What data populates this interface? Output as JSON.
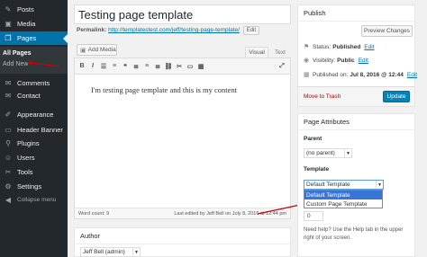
{
  "sidebar": {
    "items": [
      {
        "label": "Posts",
        "icon": "pin-icon"
      },
      {
        "label": "Media",
        "icon": "media-icon"
      },
      {
        "label": "Pages",
        "icon": "pages-icon"
      },
      {
        "label": "Comments",
        "icon": "comments-icon"
      },
      {
        "label": "Contact",
        "icon": "contact-icon"
      },
      {
        "label": "Appearance",
        "icon": "brush-icon"
      },
      {
        "label": "Header Banner",
        "icon": "banner-icon"
      },
      {
        "label": "Plugins",
        "icon": "plugin-icon"
      },
      {
        "label": "Users",
        "icon": "users-icon"
      },
      {
        "label": "Tools",
        "icon": "tools-icon"
      },
      {
        "label": "Settings",
        "icon": "settings-icon"
      },
      {
        "label": "Collapse menu",
        "icon": "collapse-icon"
      }
    ],
    "submenu": [
      "All Pages",
      "Add New"
    ]
  },
  "editor": {
    "title": "Testing page template",
    "permalink_label": "Permalink:",
    "permalink_url": "http://templatestest.com/jeff/testing-page-template/",
    "edit_label": "Edit",
    "add_media_label": "Add Media",
    "tab_visual": "Visual",
    "tab_text": "Text",
    "content": "I'm testing page template and this is my content",
    "word_count": "Word count: 9",
    "last_edited": "Last edited by Jeff Bell on July 8, 2016 at 12:44 pm"
  },
  "author": {
    "title": "Author",
    "value": "Jeff Bell (admin)"
  },
  "publish": {
    "title": "Publish",
    "preview_label": "Preview Changes",
    "status_label": "Status:",
    "status_value": "Published",
    "visibility_label": "Visibility:",
    "visibility_value": "Public",
    "published_label": "Published on:",
    "published_value": "Jul 8, 2016 @ 12:44",
    "edit_label": "Edit",
    "trash_label": "Move to Trash",
    "update_label": "Update"
  },
  "attributes": {
    "title": "Page Attributes",
    "parent_label": "Parent",
    "parent_value": "(no parent)",
    "template_label": "Template",
    "template_value": "Default Template",
    "template_options": [
      "Default Template",
      "Custom Page Template"
    ],
    "order_value": "0",
    "help_text": "Need help? Use the Help tab in the upper right of your screen."
  },
  "colors": {
    "sidebar_bg": "#23282d",
    "active_blue": "#0073aa",
    "button_blue": "#0085ba",
    "annotation_red": "#d00000"
  }
}
